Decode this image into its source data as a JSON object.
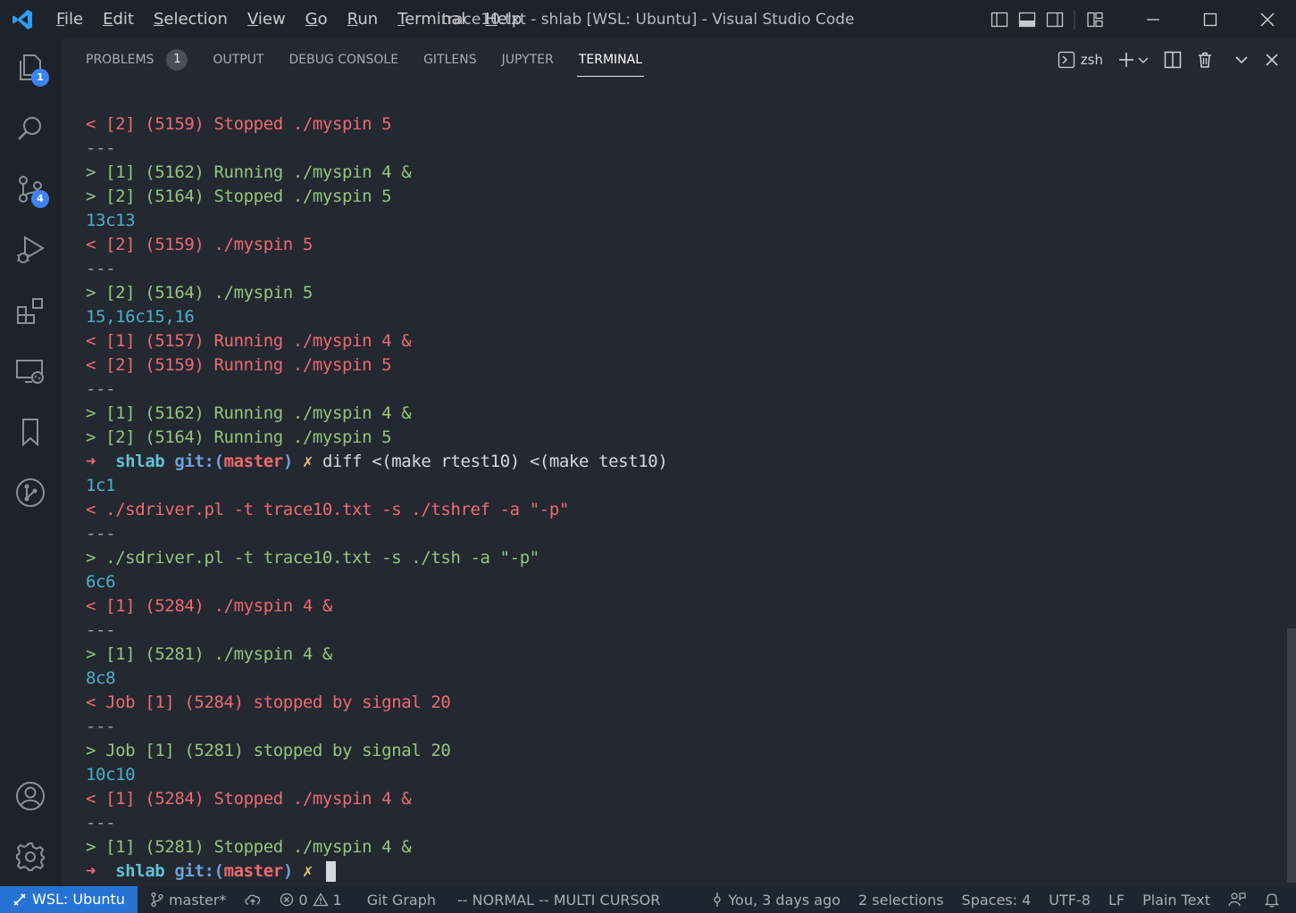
{
  "window": {
    "title": "trace10.txt - shlab [WSL: Ubuntu] - Visual Studio Code"
  },
  "menu": [
    {
      "key": "F",
      "rest": "ile"
    },
    {
      "key": "E",
      "rest": "dit"
    },
    {
      "key": "S",
      "rest": "election"
    },
    {
      "key": "V",
      "rest": "iew"
    },
    {
      "key": "G",
      "rest": "o"
    },
    {
      "key": "R",
      "rest": "un"
    },
    {
      "key": "T",
      "rest": "erminal"
    },
    {
      "key": "H",
      "rest": "elp"
    }
  ],
  "activity": {
    "explorer_badge": "1",
    "scm_badge": "4"
  },
  "panel": {
    "tabs": [
      {
        "label": "PROBLEMS",
        "badge": "1"
      },
      {
        "label": "OUTPUT"
      },
      {
        "label": "DEBUG CONSOLE"
      },
      {
        "label": "GITLENS"
      },
      {
        "label": "JUPYTER"
      },
      {
        "label": "TERMINAL",
        "active": true
      }
    ],
    "shell_label": "zsh"
  },
  "terminal": {
    "lines": [
      {
        "color": "red",
        "text": "< [2] (5159) Stopped ./myspin 5"
      },
      {
        "color": "gray",
        "text": "---"
      },
      {
        "color": "green",
        "text": "> [1] (5162) Running ./myspin 4 &"
      },
      {
        "color": "green",
        "text": "> [2] (5164) Stopped ./myspin 5"
      },
      {
        "color": "cyan",
        "text": "13c13"
      },
      {
        "color": "red",
        "text": "< [2] (5159) ./myspin 5"
      },
      {
        "color": "gray",
        "text": "---"
      },
      {
        "color": "green",
        "text": "> [2] (5164) ./myspin 5"
      },
      {
        "color": "cyan",
        "text": "15,16c15,16"
      },
      {
        "color": "red",
        "text": "< [1] (5157) Running ./myspin 4 &"
      },
      {
        "color": "red",
        "text": "< [2] (5159) Running ./myspin 5"
      },
      {
        "color": "gray",
        "text": "---"
      },
      {
        "color": "green",
        "text": "> [1] (5162) Running ./myspin 4 &"
      },
      {
        "color": "green",
        "text": "> [2] (5164) Running ./myspin 5"
      },
      {
        "prompt": true,
        "arrow": "➜",
        "dir": "shlab",
        "git": "git:(",
        "branch": "master",
        "git_close": ")",
        "x": "✗",
        "cmd": "diff <(make rtest10) <(make test10)"
      },
      {
        "color": "cyan",
        "text": "1c1"
      },
      {
        "color": "red",
        "text": "< ./sdriver.pl -t trace10.txt -s ./tshref -a \"-p\""
      },
      {
        "color": "gray",
        "text": "---"
      },
      {
        "color": "green",
        "text": "> ./sdriver.pl -t trace10.txt -s ./tsh -a \"-p\""
      },
      {
        "color": "cyan",
        "text": "6c6"
      },
      {
        "color": "red",
        "text": "< [1] (5284) ./myspin 4 &"
      },
      {
        "color": "gray",
        "text": "---"
      },
      {
        "color": "green",
        "text": "> [1] (5281) ./myspin 4 &"
      },
      {
        "color": "cyan",
        "text": "8c8"
      },
      {
        "color": "red",
        "text": "< Job [1] (5284) stopped by signal 20"
      },
      {
        "color": "gray",
        "text": "---"
      },
      {
        "color": "green",
        "text": "> Job [1] (5281) stopped by signal 20"
      },
      {
        "color": "cyan",
        "text": "10c10"
      },
      {
        "color": "red",
        "text": "< [1] (5284) Stopped ./myspin 4 &"
      },
      {
        "color": "gray",
        "text": "---"
      },
      {
        "color": "green",
        "text": "> [1] (5281) Stopped ./myspin 4 &"
      },
      {
        "prompt": true,
        "arrow": "➜",
        "dir": "shlab",
        "git": "git:(",
        "branch": "master",
        "git_close": ")",
        "x": "✗",
        "cmd": "",
        "cursor": true
      }
    ]
  },
  "status": {
    "remote": "WSL: Ubuntu",
    "branch": "master*",
    "errors": "0",
    "warnings": "1",
    "git_graph": "Git Graph",
    "vim_mode": "-- NORMAL --  MULTI CURSOR",
    "blame": "You, 3 days ago",
    "selections": "2 selections",
    "spaces": "Spaces: 4",
    "encoding": "UTF-8",
    "eol": "LF",
    "language": "Plain Text"
  },
  "colors": {
    "accent": "#2673d4",
    "badge": "#3e82f7",
    "diff_removed": "#ee6a6f",
    "diff_added": "#95c67a",
    "diff_header": "#47b2c7"
  }
}
